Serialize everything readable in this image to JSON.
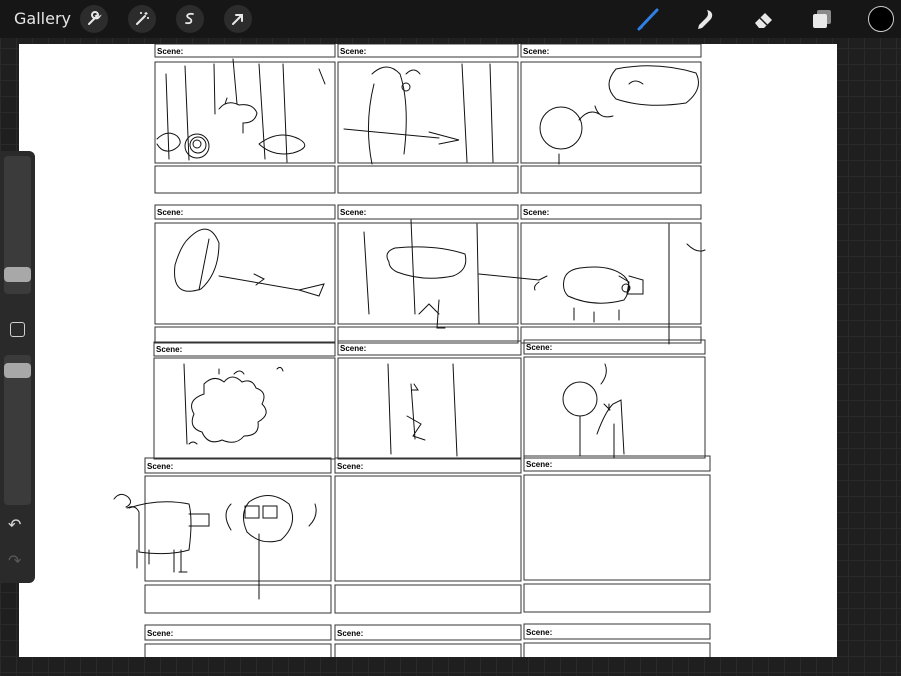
{
  "topbar": {
    "gallery_label": "Gallery",
    "left_tools": [
      "wrench-icon",
      "magic-wand-icon",
      "selection-icon",
      "transform-arrow-icon"
    ],
    "right_tools": [
      "brush-icon",
      "smudge-icon",
      "eraser-icon",
      "layers-icon"
    ],
    "active_tool": "brush-icon",
    "active_tool_color": "#2f7fe6",
    "current_color": "#000000"
  },
  "sidebar": {
    "brush_size_icon": "brush-size-slider",
    "opacity_icon": "opacity-slider",
    "modifier_icon": "modifier-square-icon",
    "undo_icon": "undo-icon",
    "redo_icon": "redo-icon",
    "brush_size_level": 0.23,
    "opacity_level": 0.17
  },
  "storyboard": {
    "scene_label": "Scene:",
    "rows": [
      {
        "scenes": [
          "Scene:",
          "Scene:",
          "Scene:"
        ]
      },
      {
        "scenes": [
          "Scene:",
          "Scene:",
          "Scene:"
        ]
      },
      {
        "scenes": [
          "Scene:",
          "Scene:",
          "Scene:"
        ]
      },
      {
        "scenes": [
          "Scene:",
          "Scene:",
          "Scene:"
        ]
      },
      {
        "scenes": [
          "Scene:",
          "Scene:",
          "Scene:"
        ]
      }
    ]
  }
}
